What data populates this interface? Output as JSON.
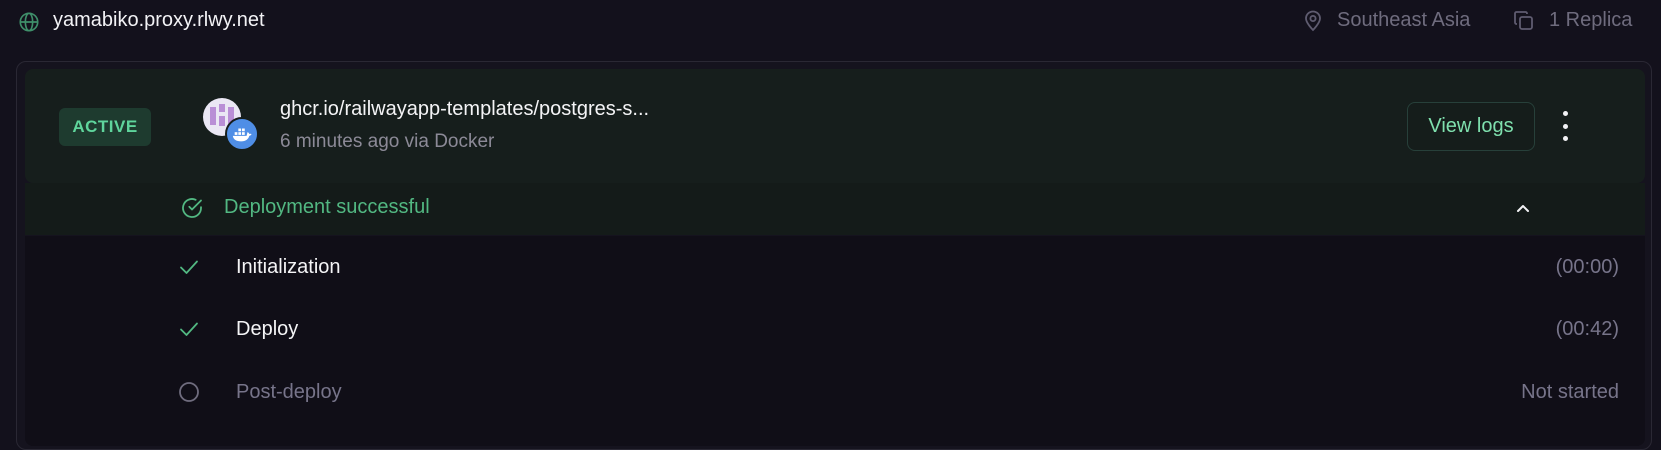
{
  "header": {
    "domain": "yamabiko.proxy.rlwy.net",
    "region": "Southeast Asia",
    "replicas": "1 Replica"
  },
  "deployment": {
    "status_badge": "ACTIVE",
    "image": "ghcr.io/railwayapp-templates/postgres-s...",
    "subtitle": "6 minutes ago via Docker",
    "view_logs_label": "View logs",
    "result": "Deployment successful"
  },
  "steps": [
    {
      "label": "Initialization",
      "time": "(00:00)",
      "state": "done"
    },
    {
      "label": "Deploy",
      "time": "(00:42)",
      "state": "done"
    },
    {
      "label": "Post-deploy",
      "time": "Not started",
      "state": "pending"
    }
  ],
  "colors": {
    "accent_green": "#52b882",
    "badge_bg": "#1e3b2f",
    "docker_blue": "#4f8ee6"
  },
  "icons": {
    "domain": "globe-icon",
    "region": "map-pin-icon",
    "replica": "copy-icon",
    "status": "check-circle-icon",
    "collapse": "chevron-up-icon",
    "step_done": "check-icon",
    "step_pending": "circle-icon",
    "more": "kebab-menu-icon"
  }
}
